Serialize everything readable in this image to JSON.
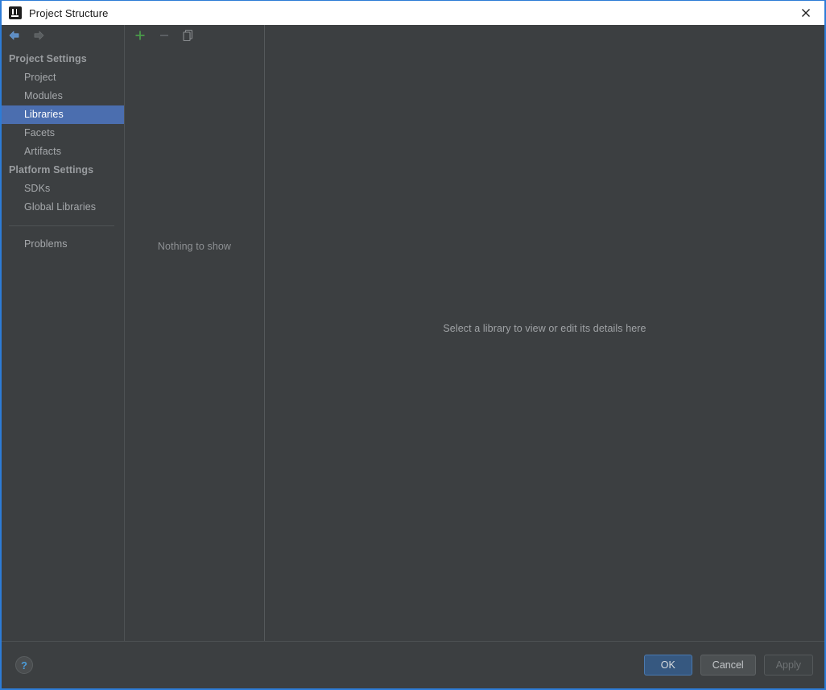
{
  "window": {
    "title": "Project Structure",
    "app_icon": "intellij-idea-logo",
    "close_label": "✕",
    "border_color": "#2d7cd6"
  },
  "navigation": {
    "back_icon": "arrow-left-icon",
    "forward_icon": "arrow-right-icon",
    "back_enabled": "true",
    "forward_enabled": "false"
  },
  "sidebar": {
    "groups": [
      {
        "header": "Project Settings",
        "items": [
          {
            "label": "Project",
            "selected": false
          },
          {
            "label": "Modules",
            "selected": false
          },
          {
            "label": "Libraries",
            "selected": true
          },
          {
            "label": "Facets",
            "selected": false
          },
          {
            "label": "Artifacts",
            "selected": false
          }
        ]
      },
      {
        "header": "Platform Settings",
        "items": [
          {
            "label": "SDKs",
            "selected": false
          },
          {
            "label": "Global Libraries",
            "selected": false
          }
        ]
      }
    ],
    "extra_items": [
      {
        "label": "Problems",
        "selected": false
      }
    ],
    "selection_color": "#4b6eaf"
  },
  "toolbar": {
    "add": {
      "icon": "plus-icon",
      "label": "Add",
      "enabled": "true",
      "color": "#4a9a4a"
    },
    "remove": {
      "icon": "minus-icon",
      "label": "Remove",
      "enabled": "false",
      "color": "#6e7274"
    },
    "copy": {
      "icon": "copy-icon",
      "label": "Copy",
      "enabled": "true",
      "color": "#8a8d90"
    }
  },
  "list_panel": {
    "empty_message": "Nothing to show"
  },
  "detail_panel": {
    "hint": "Select a library to view or edit its details here"
  },
  "footer": {
    "help": {
      "icon": "question-mark-icon",
      "label": "?"
    },
    "buttons": [
      {
        "label": "OK",
        "state": "default"
      },
      {
        "label": "Cancel",
        "state": "normal"
      },
      {
        "label": "Apply",
        "state": "disabled"
      }
    ]
  }
}
